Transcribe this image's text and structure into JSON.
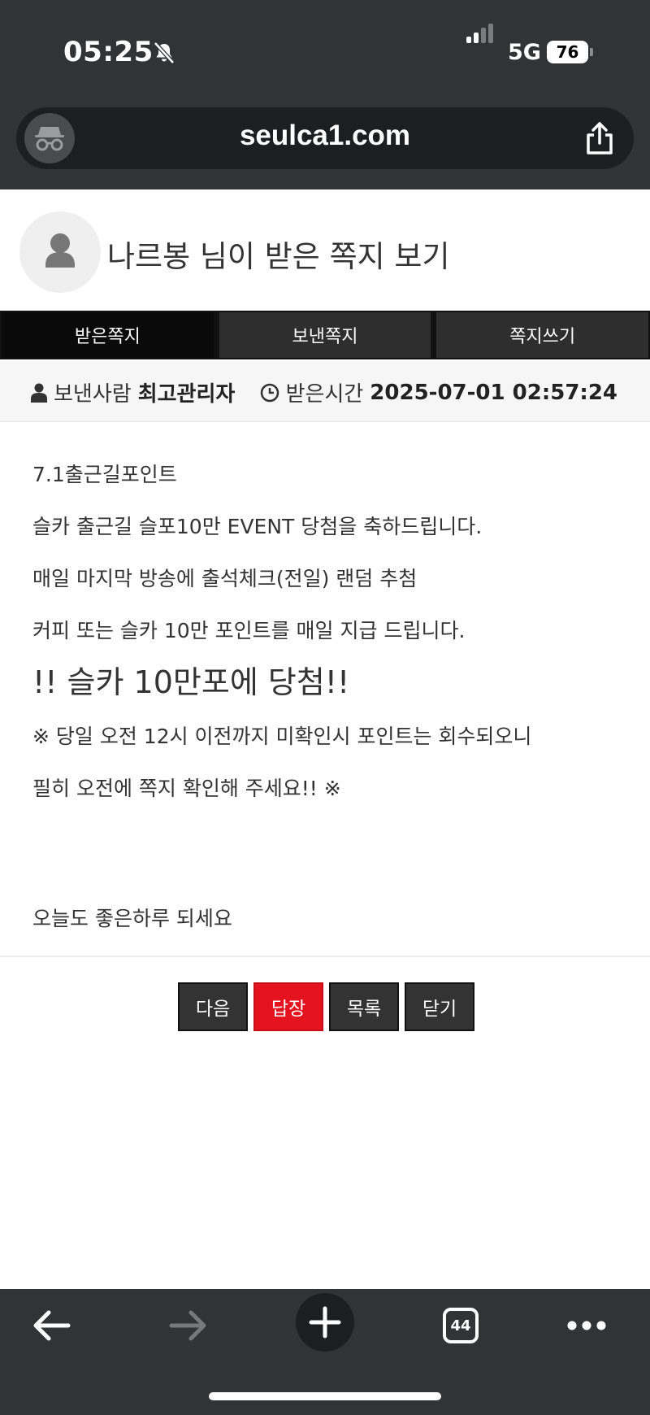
{
  "status_bar": {
    "time": "05:25",
    "network": "5G",
    "battery": "76"
  },
  "browser": {
    "url": "seulca1.com",
    "tab_count": "44"
  },
  "page": {
    "title": "나르봉 님이 받은 쪽지 보기",
    "tabs": [
      {
        "label": "받은쪽지",
        "active": true
      },
      {
        "label": "보낸쪽지",
        "active": false
      },
      {
        "label": "쪽지쓰기",
        "active": false
      }
    ],
    "meta": {
      "sender_label": "보낸사람",
      "sender_name": "최고관리자",
      "time_label": "받은시간",
      "time_value": "2025-07-01 02:57:24"
    },
    "message_lines": [
      "7.1출근길포인트",
      "슬카 출근길 슬포10만 EVENT 당첨을 축하드립니다.",
      "매일 마지막 방송에 출석체크(전일) 랜덤 추첨",
      "커피 또는 슬카 10만 포인트를 매일 지급 드립니다.",
      "!! 슬카 10만포에 당첨!!",
      "※ 당일 오전 12시 이전까지 미확인시 포인트는 회수되오니",
      "필히 오전에 쪽지 확인해 주세요!! ※",
      "오늘도 좋은하루 되세요"
    ],
    "buttons": {
      "next": "다음",
      "reply": "답장",
      "list": "목록",
      "close": "닫기"
    }
  },
  "colors": {
    "chrome": "#323335",
    "reply_button": "#e4131f",
    "dark_button": "#333333"
  }
}
